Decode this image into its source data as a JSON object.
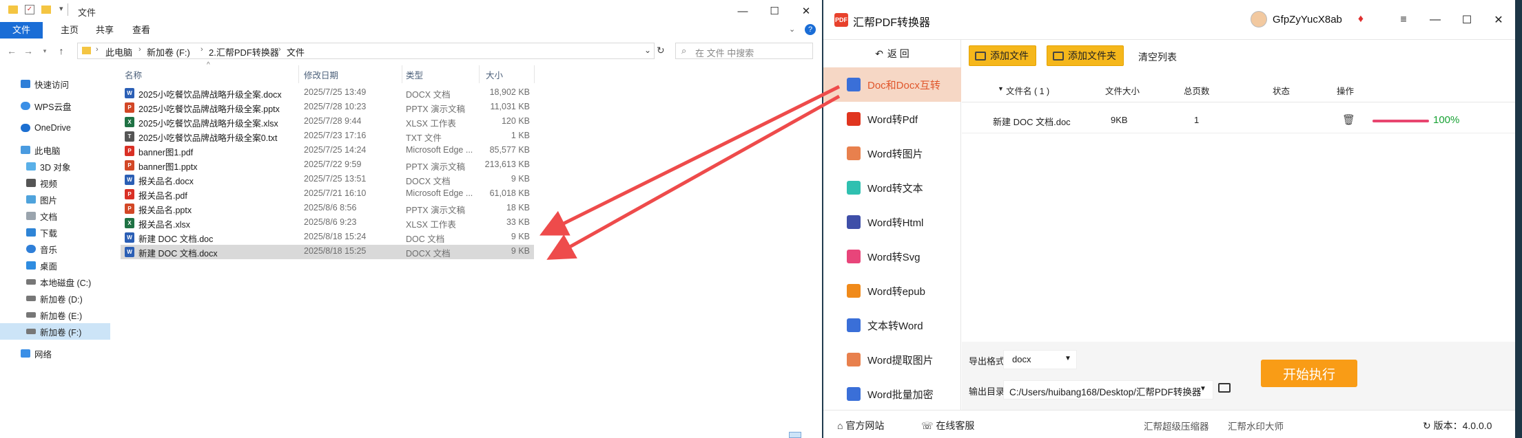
{
  "explorer": {
    "title": "文件",
    "ribbon_tabs": [
      "文件",
      "主页",
      "共享",
      "查看"
    ],
    "breadcrumbs": [
      "此电脑",
      "新加卷 (F:)",
      "2.汇帮PDF转换器",
      "文件"
    ],
    "search_placeholder": "在 文件 中搜索",
    "nav_items": [
      "快速访问",
      "WPS云盘",
      "OneDrive",
      "此电脑",
      "3D 对象",
      "视频",
      "图片",
      "文档",
      "下载",
      "音乐",
      "桌面",
      "本地磁盘 (C:)",
      "新加卷 (D:)",
      "新加卷 (E:)",
      "新加卷 (F:)",
      "网络"
    ],
    "columns": [
      "名称",
      "修改日期",
      "类型",
      "大小"
    ],
    "files": [
      {
        "name": "2025小吃餐饮品牌战略升级全案.docx",
        "date": "2025/7/25 13:49",
        "type": "DOCX 文档",
        "size": "18,902 KB",
        "icon": "word"
      },
      {
        "name": "2025小吃餐饮品牌战略升级全案.pptx",
        "date": "2025/7/28 10:23",
        "type": "PPTX 演示文稿",
        "size": "11,031 KB",
        "icon": "ppt"
      },
      {
        "name": "2025小吃餐饮品牌战略升级全案.xlsx",
        "date": "2025/7/28 9:44",
        "type": "XLSX 工作表",
        "size": "120 KB",
        "icon": "excel"
      },
      {
        "name": "2025小吃餐饮品牌战略升级全案0.txt",
        "date": "2025/7/23 17:16",
        "type": "TXT 文件",
        "size": "1 KB",
        "icon": "txt"
      },
      {
        "name": "banner图1.pdf",
        "date": "2025/7/25 14:24",
        "type": "Microsoft Edge ...",
        "size": "85,577 KB",
        "icon": "pdf"
      },
      {
        "name": "banner图1.pptx",
        "date": "2025/7/22 9:59",
        "type": "PPTX 演示文稿",
        "size": "213,613 KB",
        "icon": "ppt"
      },
      {
        "name": "报关品名.docx",
        "date": "2025/7/25 13:51",
        "type": "DOCX 文档",
        "size": "9 KB",
        "icon": "word"
      },
      {
        "name": "报关品名.pdf",
        "date": "2025/7/21 16:10",
        "type": "Microsoft Edge ...",
        "size": "61,018 KB",
        "icon": "pdf"
      },
      {
        "name": "报关品名.pptx",
        "date": "2025/8/6 8:56",
        "type": "PPTX 演示文稿",
        "size": "18 KB",
        "icon": "ppt"
      },
      {
        "name": "报关品名.xlsx",
        "date": "2025/8/6 9:23",
        "type": "XLSX 工作表",
        "size": "33 KB",
        "icon": "excel"
      },
      {
        "name": "新建 DOC 文档.doc",
        "date": "2025/8/18 15:24",
        "type": "DOC 文档",
        "size": "9 KB",
        "icon": "word"
      },
      {
        "name": "新建 DOC 文档.docx",
        "date": "2025/8/18 15:25",
        "type": "DOCX 文档",
        "size": "9 KB",
        "icon": "word"
      }
    ],
    "selected_index": 11
  },
  "converter": {
    "app_name": "汇帮PDF转换器",
    "logo_text": "PDF",
    "username": "GfpZyYucX8ab",
    "back_label": "返 回",
    "menu": [
      "Doc和Docx互转",
      "Word转Pdf",
      "Word转图片",
      "Word转文本",
      "Word转Html",
      "Word转Svg",
      "Word转epub",
      "文本转Word",
      "Word提取图片",
      "Word批量加密"
    ],
    "active_menu": 0,
    "add_file": "添加文件",
    "add_folder": "添加文件夹",
    "clear_list": "清空列表",
    "table_headers": [
      "文件名 ( 1 )",
      "文件大小",
      "总页数",
      "状态",
      "操作"
    ],
    "row": {
      "name": "新建 DOC 文档.doc",
      "size": "9KB",
      "pages": "1",
      "progress": 1.0,
      "percent": "100%"
    },
    "export_format_label": "导出格式:",
    "export_format": "docx",
    "output_dir_label": "输出目录:",
    "output_dir": "C:/Users/huibang168/Desktop/汇帮PDF转换器",
    "start_button": "开始执行",
    "status_links": [
      "官方网站",
      "在线客服",
      "汇帮超级压缩器",
      "汇帮水印大师"
    ],
    "version": "版本：4.0.0.0"
  },
  "colors": {
    "accent_orange": "#f99c16",
    "active_menu_bg": "#f6d7c5",
    "arrow_red": "#ee4b4b",
    "progress": "#e8456f",
    "success": "#18a234"
  }
}
